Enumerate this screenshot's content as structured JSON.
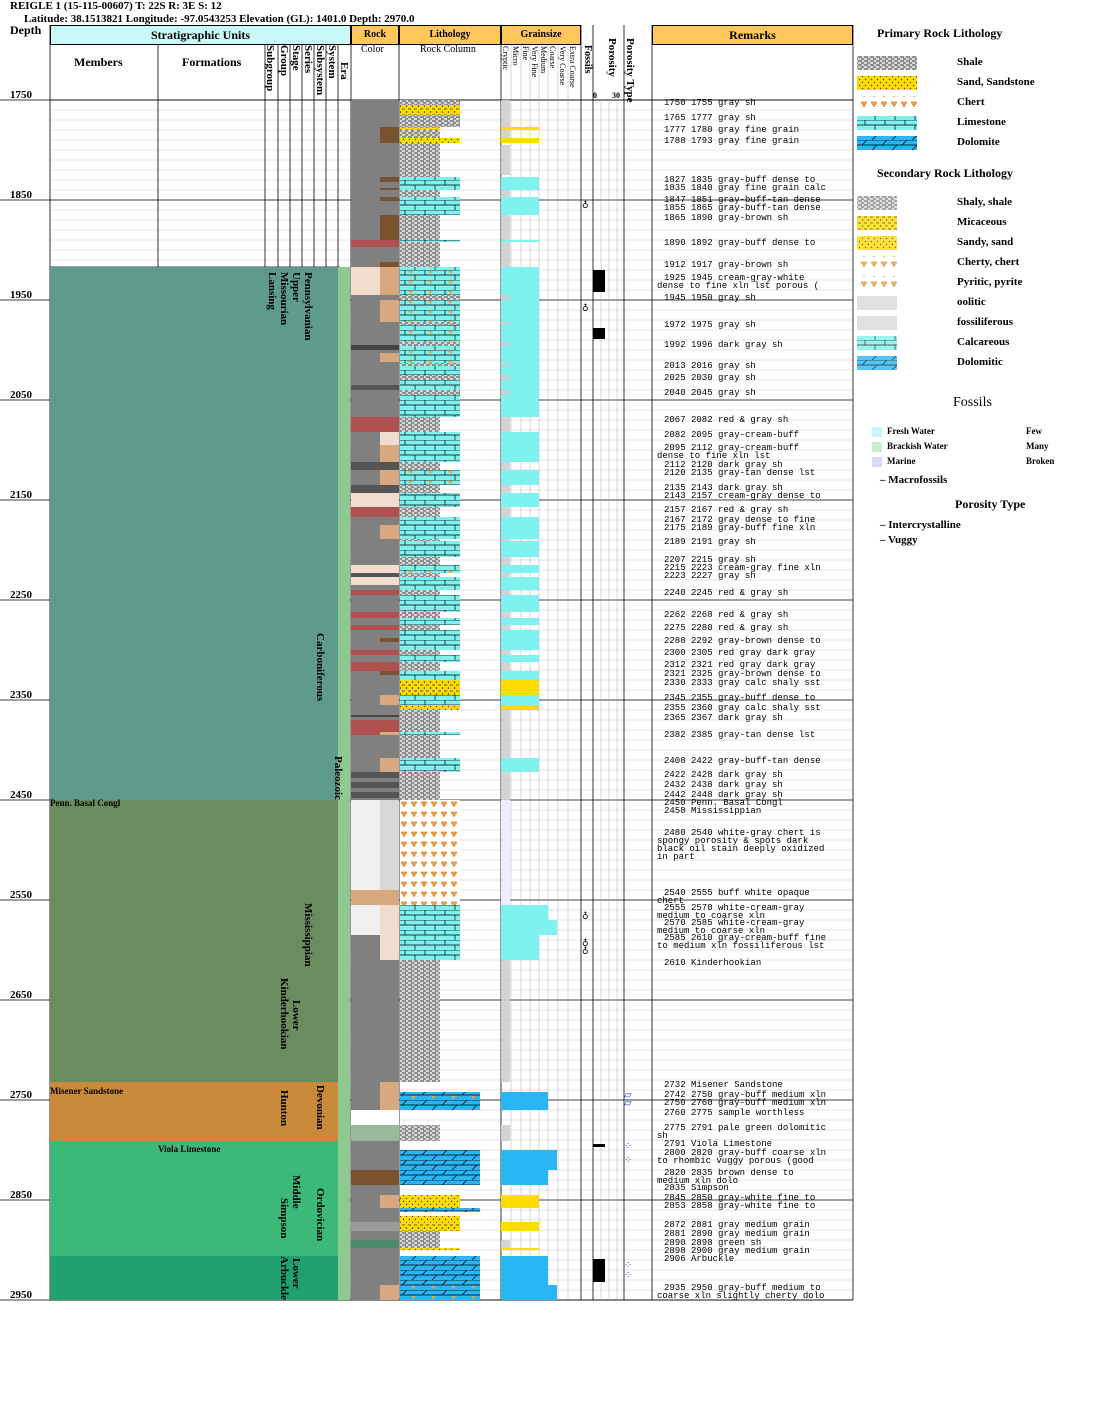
{
  "header": {
    "line1": "REIGLE 1 (15-115-00607) T: 22S R: 3E S: 12",
    "line2": "Latitude: 38.1513821 Longitude: -97.0543253 Elevation (GL): 1401.0 Depth: 2970.0"
  },
  "columns": {
    "depth": "Depth",
    "strat_units": "Stratigraphic Units",
    "members": "Members",
    "formations": "Formations",
    "strat_ranks": [
      "Subgroup",
      "Group",
      "Stage",
      "Series",
      "Subsystem",
      "System",
      "Era"
    ],
    "rock": "Rock",
    "color": "Color",
    "lithology": "Lithology",
    "rock_column": "Rock Column",
    "grainsize": "Grainsize",
    "grain_classes": [
      "Cryptic",
      "Micro",
      "Fine",
      "Very Fine",
      "Medium",
      "Coarse",
      "Very Coarse",
      "Extra Coarse"
    ],
    "fossils": "Fossils",
    "porosity": "Porosity",
    "porosity_scale": [
      "0",
      "30"
    ],
    "porosity_type": "Porosity Type",
    "remarks": "Remarks"
  },
  "depth_ticks": [
    "1750",
    "1850",
    "1950",
    "2050",
    "2150",
    "2250",
    "2350",
    "2450",
    "2550",
    "2650",
    "2750",
    "2850",
    "2950"
  ],
  "strat_labels": {
    "members": [
      {
        "text": "Penn. Basal Congl",
        "depth": 2450
      },
      {
        "text": "Misener Sandstone",
        "depth": 2738
      }
    ],
    "formations": [
      {
        "text": "Viola Limestone",
        "depth": 2796
      }
    ],
    "subgroup": [
      {
        "text": "Lansing",
        "depth": 1922
      }
    ],
    "group": [
      {
        "text": "Missourian",
        "depth": 1922
      },
      {
        "text": "Kinderhookian",
        "depth": 2628
      },
      {
        "text": "Hunton",
        "depth": 2740
      },
      {
        "text": "Simpson",
        "depth": 2848
      },
      {
        "text": "Arbuckle",
        "depth": 2906
      }
    ],
    "stage": [
      {
        "text": "Upper",
        "depth": 1922
      },
      {
        "text": "Lower",
        "depth": 2650
      },
      {
        "text": "Middle",
        "depth": 2825
      },
      {
        "text": "Lower",
        "depth": 2908
      }
    ],
    "series": [
      {
        "text": "Pennsylvanian",
        "depth": 1922
      },
      {
        "text": "Mississippian",
        "depth": 2553
      }
    ],
    "subsystem": [
      {
        "text": "Carboniferous",
        "depth": 2283
      },
      {
        "text": "Devonian",
        "depth": 2735
      },
      {
        "text": "Ordovician",
        "depth": 2838
      }
    ],
    "era": [
      {
        "text": "Paleozoic",
        "depth": 2406
      }
    ]
  },
  "remarks": [
    {
      "depth": 1750,
      "lines": [
        "1750 1755 gray sh"
      ]
    },
    {
      "depth": 1765,
      "lines": [
        "1765 1777 gray sh"
      ]
    },
    {
      "depth": 1777,
      "lines": [
        "1777 1780 gray fine grain"
      ]
    },
    {
      "depth": 1788,
      "lines": [
        "1788 1793 gray fine grain"
      ]
    },
    {
      "depth": 1827,
      "lines": [
        "1827 1835 gray-buff dense to"
      ]
    },
    {
      "depth": 1835,
      "lines": [
        "1835 1840 gray fine grain calc"
      ]
    },
    {
      "depth": 1847,
      "lines": [
        "1847 1851 gray-buff-tan dense"
      ]
    },
    {
      "depth": 1855,
      "lines": [
        "1855 1865 gray-buff-tan dense"
      ]
    },
    {
      "depth": 1865,
      "lines": [
        "1865 1890 gray-brown sh"
      ]
    },
    {
      "depth": 1890,
      "lines": [
        "1890 1892 gray-buff dense to"
      ]
    },
    {
      "depth": 1912,
      "lines": [
        "1912 1917 gray-brown sh"
      ]
    },
    {
      "depth": 1925,
      "lines": [
        "1925 1945 cream-gray-white",
        "dense to fine xln lst porous ("
      ]
    },
    {
      "depth": 1945,
      "lines": [
        "1945 1950 gray sh"
      ]
    },
    {
      "depth": 1972,
      "lines": [
        "1972 1975 gray sh"
      ]
    },
    {
      "depth": 1992,
      "lines": [
        "1992 1996 dark gray sh"
      ]
    },
    {
      "depth": 2013,
      "lines": [
        "2013 2016 gray sh"
      ]
    },
    {
      "depth": 2025,
      "lines": [
        "2025 2030 gray sh"
      ]
    },
    {
      "depth": 2040,
      "lines": [
        "2040 2045 gray sh"
      ]
    },
    {
      "depth": 2067,
      "lines": [
        "2067 2082 red & gray sh"
      ]
    },
    {
      "depth": 2082,
      "lines": [
        "2082 2095 gray-cream-buff"
      ]
    },
    {
      "depth": 2095,
      "lines": [
        "2095 2112 gray-cream-buff",
        "dense to fine xln lst"
      ]
    },
    {
      "depth": 2112,
      "lines": [
        "2112 2120 dark gray sh"
      ]
    },
    {
      "depth": 2120,
      "lines": [
        "2120 2135 gray-tan dense lst"
      ]
    },
    {
      "depth": 2135,
      "lines": [
        "2135 2143 dark gray sh"
      ]
    },
    {
      "depth": 2143,
      "lines": [
        "2143 2157 cream-gray dense to"
      ]
    },
    {
      "depth": 2157,
      "lines": [
        "2157 2167 red & gray sh"
      ]
    },
    {
      "depth": 2167,
      "lines": [
        "2167 2172 gray dense to fine"
      ]
    },
    {
      "depth": 2175,
      "lines": [
        "2175 2189 gray-buff fine xln"
      ]
    },
    {
      "depth": 2189,
      "lines": [
        "2189 2191 gray sh"
      ]
    },
    {
      "depth": 2207,
      "lines": [
        "2207 2215 gray sh"
      ]
    },
    {
      "depth": 2215,
      "lines": [
        "2215 2223 cream-gray fine xln"
      ]
    },
    {
      "depth": 2223,
      "lines": [
        "2223 2227 gray sh"
      ]
    },
    {
      "depth": 2240,
      "lines": [
        "2240 2245 red & gray sh"
      ]
    },
    {
      "depth": 2262,
      "lines": [
        "2262 2268 red & gray sh"
      ]
    },
    {
      "depth": 2275,
      "lines": [
        "2275 2280 red & gray sh"
      ]
    },
    {
      "depth": 2288,
      "lines": [
        "2288 2292 gray-brown dense to"
      ]
    },
    {
      "depth": 2300,
      "lines": [
        "2300 2305 red gray dark gray"
      ]
    },
    {
      "depth": 2312,
      "lines": [
        "2312 2321 red gray dark gray"
      ]
    },
    {
      "depth": 2321,
      "lines": [
        "2321 2325 gray-brown dense to"
      ]
    },
    {
      "depth": 2330,
      "lines": [
        "2330 2333 gray calc shaly sst"
      ]
    },
    {
      "depth": 2345,
      "lines": [
        "2345 2355 gray-buff dense to"
      ]
    },
    {
      "depth": 2355,
      "lines": [
        "2355 2360 gray calc shaly sst"
      ]
    },
    {
      "depth": 2365,
      "lines": [
        "2365 2367 dark gray sh"
      ]
    },
    {
      "depth": 2382,
      "lines": [
        "2382 2385 gray-tan dense lst"
      ]
    },
    {
      "depth": 2408,
      "lines": [
        "2408 2422 gray-buff-tan dense"
      ]
    },
    {
      "depth": 2422,
      "lines": [
        "2422 2428 dark gray sh"
      ]
    },
    {
      "depth": 2432,
      "lines": [
        "2432 2438 dark gray sh"
      ]
    },
    {
      "depth": 2442,
      "lines": [
        "2442 2448 dark gray sh"
      ]
    },
    {
      "depth": 2450,
      "lines": [
        "2450 Penn. Basal Congl"
      ]
    },
    {
      "depth": 2458,
      "lines": [
        "2458 Mississippian"
      ]
    },
    {
      "depth": 2480,
      "lines": [
        "2480 2540 white-gray chert is",
        "spongy porosity & spots dark",
        "black oil stain deeply oxidized",
        "in part"
      ]
    },
    {
      "depth": 2540,
      "lines": [
        "2540 2555 buff white opaque",
        "chert"
      ]
    },
    {
      "depth": 2555,
      "lines": [
        "2555 2570 white-cream-gray",
        "medium to coarse xln"
      ]
    },
    {
      "depth": 2570,
      "lines": [
        "2570 2585 white-cream-gray",
        "medium to coarse xln"
      ]
    },
    {
      "depth": 2585,
      "lines": [
        "2585 2610 gray-cream-buff fine",
        "to medium xln fossiliferous lst"
      ]
    },
    {
      "depth": 2610,
      "lines": [
        "2610 Kinderhookian"
      ]
    },
    {
      "depth": 2732,
      "lines": [
        "2732 Misener Sandstone"
      ]
    },
    {
      "depth": 2742,
      "lines": [
        "2742 2750 gray-buff medium xln"
      ]
    },
    {
      "depth": 2750,
      "lines": [
        "2750 2760 gray-buff medium xln"
      ]
    },
    {
      "depth": 2760,
      "lines": [
        "2760 2775 sample worthless"
      ]
    },
    {
      "depth": 2775,
      "lines": [
        "2775 2791 pale green dolomitic",
        "sh"
      ]
    },
    {
      "depth": 2791,
      "lines": [
        "2791 Viola Limestone"
      ]
    },
    {
      "depth": 2800,
      "lines": [
        "2800 2820 gray-buff coarse xln",
        "to rhombic vuggy porous (good"
      ]
    },
    {
      "depth": 2820,
      "lines": [
        "2820 2835 brown dense to",
        "medium xln dolo"
      ]
    },
    {
      "depth": 2835,
      "lines": [
        "2835 Simpson"
      ]
    },
    {
      "depth": 2845,
      "lines": [
        "2845 2850 gray-white fine to"
      ]
    },
    {
      "depth": 2853,
      "lines": [
        "2853 2858 gray-white fine to"
      ]
    },
    {
      "depth": 2872,
      "lines": [
        "2872 2881 gray medium grain"
      ]
    },
    {
      "depth": 2881,
      "lines": [
        "2881 2890 gray medium grain"
      ]
    },
    {
      "depth": 2890,
      "lines": [
        "2890 2898 green sh"
      ]
    },
    {
      "depth": 2898,
      "lines": [
        "2898 2900 gray medium grain"
      ]
    },
    {
      "depth": 2906,
      "lines": [
        "2906 Arbuckle"
      ]
    },
    {
      "depth": 2935,
      "lines": [
        "2935 2950 gray-buff medium to",
        "coarse xln slightly cherty dolo"
      ]
    }
  ],
  "legend": {
    "primary_title": "Primary Rock Lithology",
    "primary": [
      "Shale",
      "Sand, Sandstone",
      "Chert",
      "Limestone",
      "Dolomite"
    ],
    "secondary_title": "Secondary Rock Lithology",
    "secondary": [
      "Shaly, shale",
      "Micaceous",
      "Sandy, sand",
      "Cherty, chert",
      "Pyritic, pyrite",
      "oolitic",
      "fossiliferous",
      "Calcareous",
      "Dolomitic"
    ],
    "fossils_title": "Fossils",
    "fossil_env": [
      "Fresh Water",
      "Brackish Water",
      "Marine"
    ],
    "fossil_abund": [
      "Few",
      "Many",
      "Broken"
    ],
    "macrofossils": "– Macrofossils",
    "porosity_title": "Porosity Type",
    "porosity_types": [
      "– Intercrystalline",
      "– Vuggy"
    ]
  },
  "colors": {
    "header": "#ffc75a",
    "limestone": "#7ff1ee",
    "dolomite": "#2ab5f4",
    "sand": "#ffdc00",
    "shale_gray": "#808080",
    "penn": "#5f9b8c",
    "miss": "#6b8c5e",
    "devonian": "#c98a3a",
    "ordovician": "#3cb878"
  }
}
